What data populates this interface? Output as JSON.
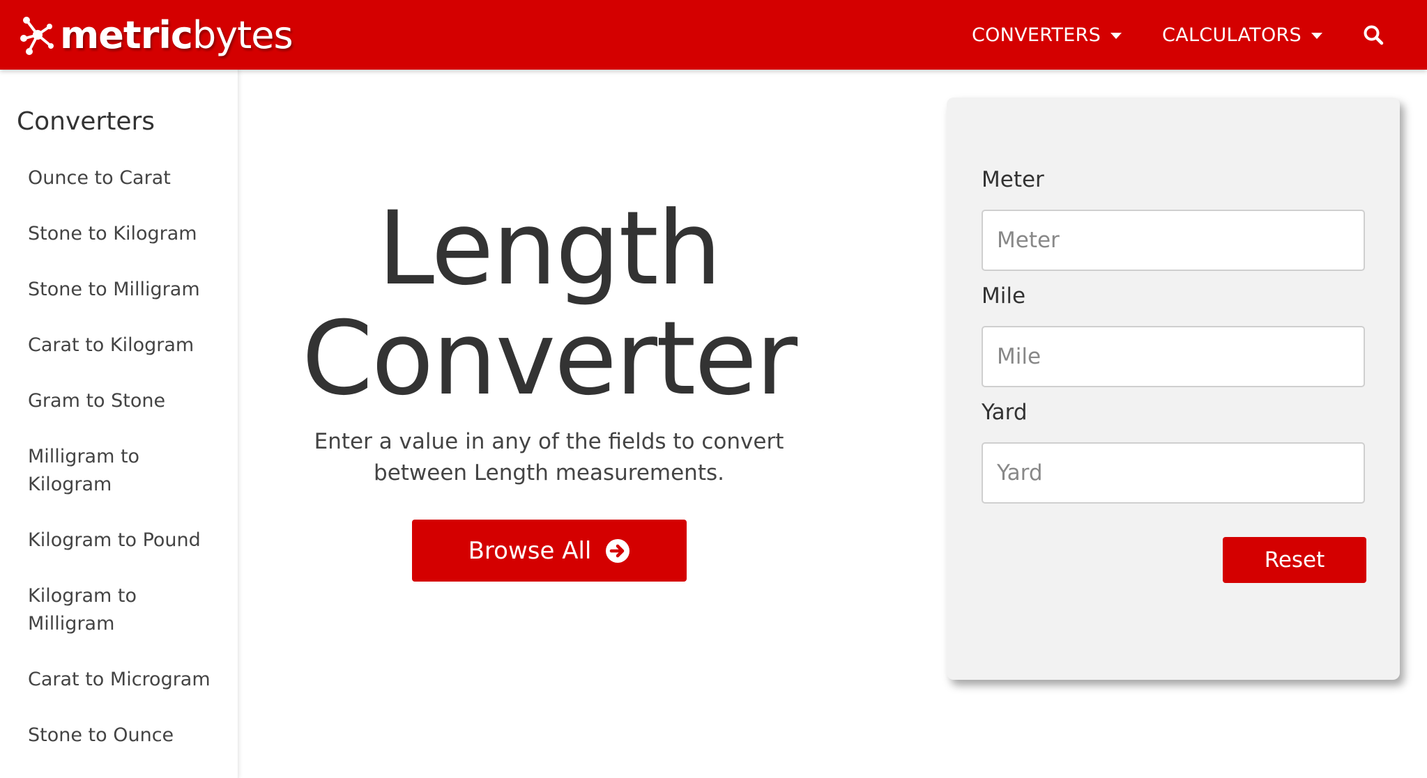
{
  "header": {
    "logo_text_bold": "metric",
    "logo_text_rest": "bytes",
    "nav": [
      {
        "label": "CONVERTERS"
      },
      {
        "label": "CALCULATORS"
      }
    ],
    "search_icon": "search-icon",
    "brand_color": "#d40000"
  },
  "sidebar": {
    "title": "Converters",
    "items": [
      {
        "label": "Ounce to Carat"
      },
      {
        "label": "Stone to Kilogram"
      },
      {
        "label": "Stone to Milligram"
      },
      {
        "label": "Carat to Kilogram"
      },
      {
        "label": "Gram to Stone"
      },
      {
        "label": "Milligram to Kilogram"
      },
      {
        "label": "Kilogram to Pound"
      },
      {
        "label": "Kilogram to Milligram"
      },
      {
        "label": "Carat to Microgram"
      },
      {
        "label": "Stone to Ounce"
      }
    ]
  },
  "hero": {
    "title_line1": "Length",
    "title_line2": "Converter",
    "description": "Enter a value in any of the fields to convert between Length measurements.",
    "browse_label": "Browse All",
    "browse_icon": "arrow-circle-right-icon"
  },
  "converter": {
    "fields": [
      {
        "label": "Meter",
        "placeholder": "Meter",
        "value": ""
      },
      {
        "label": "Mile",
        "placeholder": "Mile",
        "value": ""
      },
      {
        "label": "Yard",
        "placeholder": "Yard",
        "value": ""
      }
    ],
    "reset_label": "Reset"
  }
}
